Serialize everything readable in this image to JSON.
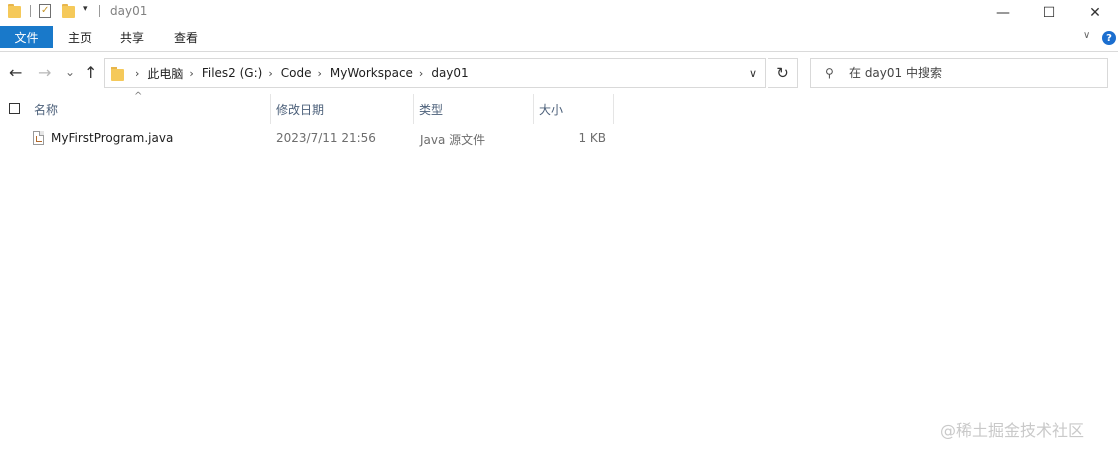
{
  "window": {
    "title": "day01",
    "minimize_glyph": "—",
    "maximize_glyph": "☐",
    "close_glyph": "✕"
  },
  "quick_access": {
    "dropdown_glyph": "▾",
    "icons": [
      "folder-icon",
      "properties-icon",
      "new-folder-icon"
    ]
  },
  "ribbon": {
    "file_tab": "文件",
    "tabs": [
      "主页",
      "共享",
      "查看"
    ],
    "expand_glyph": "∨",
    "help_glyph": "?"
  },
  "nav": {
    "back_glyph": "←",
    "forward_glyph": "→",
    "recent_glyph": "⌄",
    "up_glyph": "↑",
    "breadcrumb": [
      "此电脑",
      "Files2 (G:)",
      "Code",
      "MyWorkspace",
      "day01"
    ],
    "breadcrumb_sep": "›",
    "dropdown_glyph": "∨",
    "refresh_glyph": "↻"
  },
  "search": {
    "icon_glyph": "⚲",
    "placeholder": "在 day01 中搜索"
  },
  "columns": {
    "sort_glyph": "^",
    "name": "名称",
    "modified": "修改日期",
    "type": "类型",
    "size": "大小"
  },
  "files": [
    {
      "name": "MyFirstProgram.java",
      "modified": "2023/7/11 21:56",
      "type": "Java 源文件",
      "size": "1 KB"
    }
  ],
  "watermark": "@稀土掘金技术社区",
  "colors": {
    "file_tab_bg": "#1979ca",
    "folder": "#f5c95a",
    "header_text": "#4c607a",
    "help_icon": "#1b6ecf"
  }
}
